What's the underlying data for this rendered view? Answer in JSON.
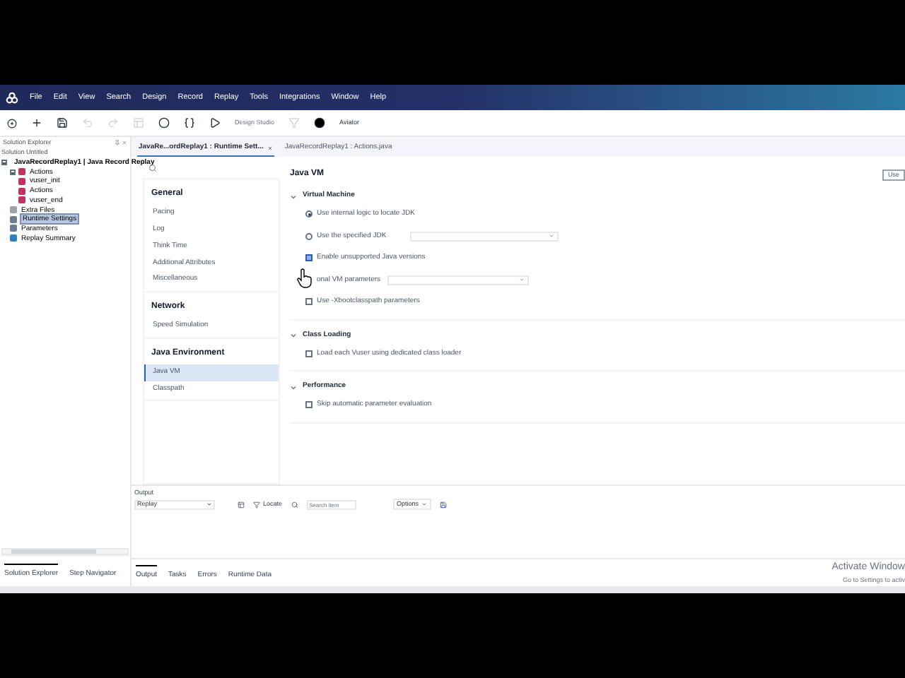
{
  "menu": {
    "items": [
      "File",
      "Edit",
      "View",
      "Search",
      "Design",
      "Record",
      "Replay",
      "Tools",
      "Integrations",
      "Window",
      "Help"
    ]
  },
  "toolbar": {
    "design_studio": {
      "label": "Design Studio",
      "disabled": true
    },
    "aviator": {
      "label": "Aviator",
      "disabled": false
    }
  },
  "solution_explorer": {
    "title": "Solution Explorer",
    "solution": "Solution Untitled",
    "tree": [
      {
        "label": "JavaRecordReplay1 | Java Record Replay",
        "kind": "script",
        "selected": false,
        "expanded": true,
        "children": [
          {
            "label": "Actions",
            "kind": "actions",
            "selected": false,
            "expanded": true,
            "children": [
              {
                "label": "vuser_init",
                "kind": "action",
                "selected": false
              },
              {
                "label": "Actions",
                "kind": "action",
                "selected": false
              },
              {
                "label": "vuser_end",
                "kind": "action",
                "selected": false
              }
            ]
          },
          {
            "label": "Extra Files",
            "kind": "files",
            "selected": false
          },
          {
            "label": "Runtime Settings",
            "kind": "settings",
            "selected": true
          },
          {
            "label": "Parameters",
            "kind": "params",
            "selected": false
          },
          {
            "label": "Replay Summary",
            "kind": "summary",
            "selected": false
          }
        ]
      }
    ]
  },
  "editor_tabs": [
    {
      "label": "JavaRe...ordReplay1 : Runtime Sett...",
      "selected": true,
      "closable": true
    },
    {
      "label": "JavaRecordReplay1 : Actions.java",
      "selected": false,
      "closable": false
    }
  ],
  "settings_nav": [
    {
      "heading": "General",
      "items": [
        {
          "label": "Pacing",
          "selected": false
        },
        {
          "label": "Log",
          "selected": false
        },
        {
          "label": "Think Time",
          "selected": false
        },
        {
          "label": "Additional Attributes",
          "selected": false
        },
        {
          "label": "Miscellaneous",
          "selected": false
        }
      ]
    },
    {
      "heading": "Network",
      "items": [
        {
          "label": "Speed Simulation",
          "selected": false
        }
      ]
    },
    {
      "heading": "Java Environment",
      "items": [
        {
          "label": "Java VM",
          "selected": true
        },
        {
          "label": "Classpath",
          "selected": false
        }
      ]
    }
  ],
  "java_vm": {
    "title": "Java VM",
    "button": "Use",
    "groups": [
      {
        "title": "Virtual Machine",
        "expanded": true,
        "options": [
          {
            "kind": "radio",
            "label": "Use internal logic to locate JDK",
            "checked": true
          },
          {
            "kind": "radio-select",
            "label": "Use the specified JDK",
            "checked": false
          },
          {
            "kind": "checkbox",
            "label": "Enable unsupported Java versions",
            "checked": true
          },
          {
            "kind": "label-select",
            "label": "onal VM parameters"
          },
          {
            "kind": "checkbox",
            "label": "Use -Xbootclasspath parameters",
            "checked": false
          }
        ]
      },
      {
        "title": "Class Loading",
        "expanded": true,
        "options": [
          {
            "kind": "checkbox",
            "label": "Load each Vuser using dedicated class loader",
            "checked": false
          }
        ]
      },
      {
        "title": "Performance",
        "expanded": true,
        "options": [
          {
            "kind": "checkbox",
            "label": "Skip automatic parameter evaluation",
            "checked": false
          }
        ]
      }
    ]
  },
  "output": {
    "title": "Output",
    "source": "Replay",
    "locate": "Locate",
    "search_placeholder": "Search item",
    "options": "Options"
  },
  "left_tabs": [
    {
      "label": "Solution Explorer",
      "selected": true
    },
    {
      "label": "Step Navigator",
      "selected": false
    }
  ],
  "bottom_tabs": [
    {
      "label": "Output",
      "selected": true
    },
    {
      "label": "Tasks",
      "selected": false
    },
    {
      "label": "Errors",
      "selected": false
    },
    {
      "label": "Runtime Data",
      "selected": false
    }
  ],
  "os_notice": {
    "title": "Activate Window",
    "detail": "Go to Settings to activ"
  }
}
